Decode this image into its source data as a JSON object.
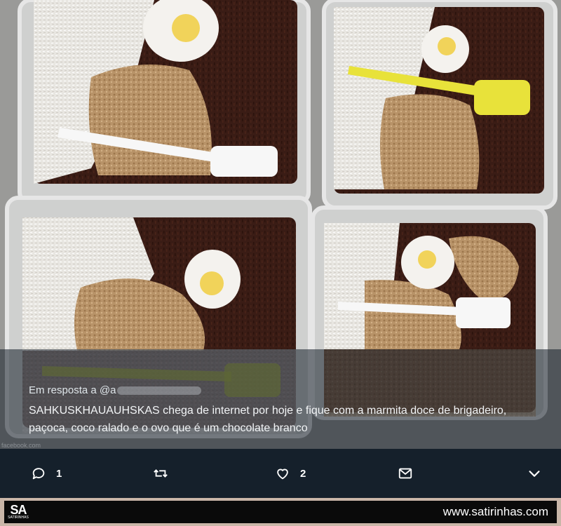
{
  "tweet": {
    "reply_prefix": "Em resposta a",
    "reply_handle": "@a",
    "text": "SAHKUSKHAUAUHSKAS chega de internet por hoje e fique com a marmita doce de brigadeiro, paçoca, coco ralado e o ovo que é um chocolate branco",
    "source_text": "facebook.com"
  },
  "actions": {
    "reply": {
      "icon": "reply-icon",
      "count": "1"
    },
    "retweet": {
      "icon": "retweet-icon"
    },
    "like": {
      "icon": "heart-icon",
      "count": "2"
    },
    "dm": {
      "icon": "envelope-icon"
    },
    "more": {
      "icon": "chevron-down-icon"
    }
  },
  "footer": {
    "logo_mark": "SA",
    "logo_sub": "SATIRINHAS",
    "site": "www.satirinhas.com"
  },
  "colors": {
    "action_bar": "#15202b",
    "footer_bar": "#0a0a0a",
    "icon": "#ffffff"
  }
}
